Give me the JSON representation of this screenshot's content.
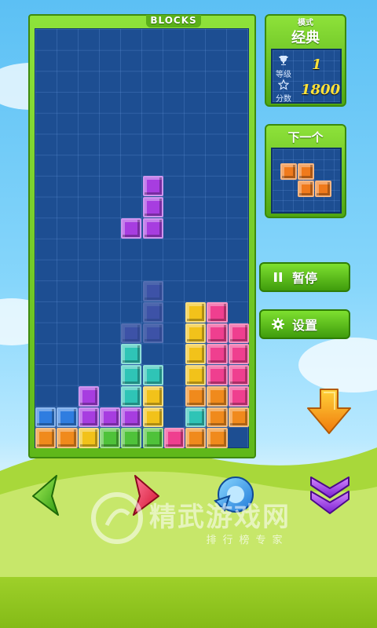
{
  "board": {
    "title": "BLOCKS",
    "cols": 10,
    "rows": 20,
    "falling_piece": {
      "color": "#a73de0",
      "cells": [
        [
          5,
          7
        ],
        [
          5,
          8
        ],
        [
          5,
          9
        ],
        [
          4,
          9
        ]
      ]
    },
    "ghost_piece": {
      "color": "#7a5ad0",
      "cells": [
        [
          5,
          12
        ],
        [
          5,
          13
        ],
        [
          5,
          14
        ],
        [
          4,
          14
        ]
      ]
    },
    "stack": [
      {
        "x": 7,
        "y": 13,
        "c": "#f2c21a"
      },
      {
        "x": 8,
        "y": 13,
        "c": "#ef3f8f"
      },
      {
        "x": 7,
        "y": 14,
        "c": "#f2c21a"
      },
      {
        "x": 8,
        "y": 14,
        "c": "#ef3f8f"
      },
      {
        "x": 9,
        "y": 14,
        "c": "#ef3f8f"
      },
      {
        "x": 4,
        "y": 15,
        "c": "#2fc4b6"
      },
      {
        "x": 7,
        "y": 15,
        "c": "#f2c21a"
      },
      {
        "x": 8,
        "y": 15,
        "c": "#ef3f8f"
      },
      {
        "x": 9,
        "y": 15,
        "c": "#ef3f8f"
      },
      {
        "x": 4,
        "y": 16,
        "c": "#2fc4b6"
      },
      {
        "x": 5,
        "y": 16,
        "c": "#2fc4b6"
      },
      {
        "x": 7,
        "y": 16,
        "c": "#f2c21a"
      },
      {
        "x": 8,
        "y": 16,
        "c": "#ef3f8f"
      },
      {
        "x": 9,
        "y": 16,
        "c": "#ef3f8f"
      },
      {
        "x": 2,
        "y": 17,
        "c": "#a73de0"
      },
      {
        "x": 4,
        "y": 17,
        "c": "#2fc4b6"
      },
      {
        "x": 5,
        "y": 17,
        "c": "#f2c21a"
      },
      {
        "x": 7,
        "y": 17,
        "c": "#f08a1c"
      },
      {
        "x": 8,
        "y": 17,
        "c": "#f08a1c"
      },
      {
        "x": 9,
        "y": 17,
        "c": "#ef3f8f"
      },
      {
        "x": 0,
        "y": 18,
        "c": "#2f7de0"
      },
      {
        "x": 1,
        "y": 18,
        "c": "#2f7de0"
      },
      {
        "x": 2,
        "y": 18,
        "c": "#a73de0"
      },
      {
        "x": 3,
        "y": 18,
        "c": "#a73de0"
      },
      {
        "x": 4,
        "y": 18,
        "c": "#a73de0"
      },
      {
        "x": 5,
        "y": 18,
        "c": "#f2c21a"
      },
      {
        "x": 7,
        "y": 18,
        "c": "#2fc4b6"
      },
      {
        "x": 8,
        "y": 18,
        "c": "#f08a1c"
      },
      {
        "x": 9,
        "y": 18,
        "c": "#f08a1c"
      },
      {
        "x": 0,
        "y": 19,
        "c": "#f08a1c"
      },
      {
        "x": 1,
        "y": 19,
        "c": "#f08a1c"
      },
      {
        "x": 2,
        "y": 19,
        "c": "#f2c21a"
      },
      {
        "x": 3,
        "y": 19,
        "c": "#4fc23a"
      },
      {
        "x": 4,
        "y": 19,
        "c": "#4fc23a"
      },
      {
        "x": 5,
        "y": 19,
        "c": "#4fc23a"
      },
      {
        "x": 6,
        "y": 19,
        "c": "#ef3f8f"
      },
      {
        "x": 7,
        "y": 19,
        "c": "#f08a1c"
      },
      {
        "x": 8,
        "y": 19,
        "c": "#f08a1c"
      }
    ]
  },
  "mode_panel": {
    "header": "模式",
    "title": "经典",
    "level_label": "等级",
    "level_value": "1",
    "score_label": "分数",
    "score_value": "1800",
    "level_icon": "trophy-icon",
    "score_icon": "star-icon"
  },
  "next_panel": {
    "title": "下一个",
    "piece": {
      "color": "#f07a1c",
      "cells": [
        [
          0,
          0
        ],
        [
          1,
          0
        ],
        [
          1,
          1
        ],
        [
          2,
          1
        ]
      ]
    }
  },
  "menu": {
    "pause_label": "暂停",
    "pause_icon": "pause-icon",
    "settings_label": "设置",
    "settings_icon": "gear-icon"
  },
  "controls": {
    "drop_icon": "arrow-down-icon",
    "left_icon": "arrow-left-icon",
    "right_icon": "arrow-right-icon",
    "rotate_icon": "rotate-icon",
    "harddrop_icon": "double-chevron-down-icon"
  },
  "watermark": {
    "title": "精武游戏网",
    "subtitle": "排行榜专家"
  }
}
